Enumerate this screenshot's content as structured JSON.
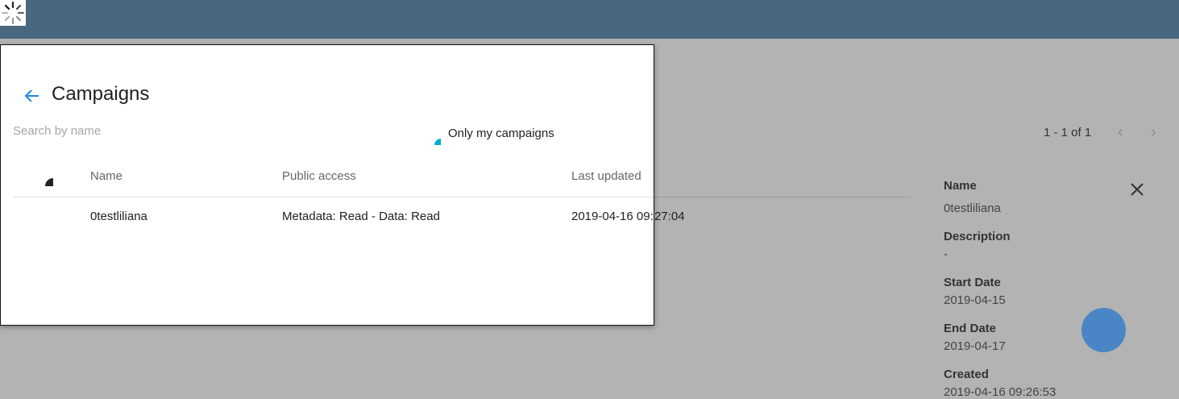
{
  "page": {
    "pagination": "1 - 1 of 1",
    "prev_icon": "chevron-left-icon",
    "next_icon": "chevron-right-icon",
    "fab_color": "#4a86c5",
    "topbar_color": "#4a6780",
    "accent_color": "#1e88e5"
  },
  "dialog": {
    "title": "Campaigns",
    "search_placeholder": "Search by name",
    "only_mine_label": "Only my campaigns",
    "columns": [
      "Name",
      "Public access",
      "Last updated"
    ],
    "rows": [
      {
        "name": "0testliliana",
        "access": "Metadata: Read - Data: Read",
        "updated": "2019-04-16 09:27:04"
      }
    ]
  },
  "details": {
    "name_label": "Name",
    "name_value": "0testliliana",
    "description_label": "Description",
    "description_value": "-",
    "start_label": "Start Date",
    "start_value": "2019-04-15",
    "end_label": "End Date",
    "end_value": "2019-04-17",
    "created_label": "Created",
    "created_value": "2019-04-16 09:26:53"
  }
}
